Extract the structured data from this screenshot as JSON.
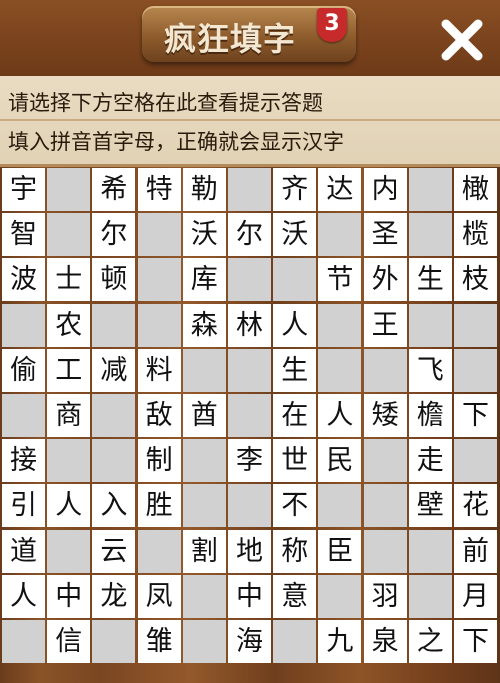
{
  "header": {
    "title": "疯狂填字",
    "level_badge": "3",
    "close_icon": "close-icon"
  },
  "hints": {
    "line1": "请选择下方空格在此查看提示答题",
    "line2": "填入拼音首字母，正确就会显示汉字"
  },
  "grid": [
    [
      "宇",
      "",
      "希",
      "特",
      "勒",
      "",
      "齐",
      "达",
      "内",
      "",
      "橄"
    ],
    [
      "智",
      "",
      "尔",
      "",
      "沃",
      "尔",
      "沃",
      "",
      "圣",
      "",
      "榄"
    ],
    [
      "波",
      "士",
      "顿",
      "",
      "库",
      "",
      "",
      "节",
      "外",
      "生",
      "枝"
    ],
    [
      "",
      "农",
      "",
      "",
      "森",
      "林",
      "人",
      "",
      "王",
      "",
      ""
    ],
    [
      "偷",
      "工",
      "减",
      "料",
      "",
      "",
      "生",
      "",
      "",
      "飞",
      ""
    ],
    [
      "",
      "商",
      "",
      "敌",
      "酋",
      "",
      "在",
      "人",
      "矮",
      "檐",
      "下"
    ],
    [
      "接",
      "",
      "",
      "制",
      "",
      "李",
      "世",
      "民",
      "",
      "走",
      ""
    ],
    [
      "引",
      "人",
      "入",
      "胜",
      "",
      "",
      "不",
      "",
      "",
      "壁",
      "花"
    ],
    [
      "道",
      "",
      "云",
      "",
      "割",
      "地",
      "称",
      "臣",
      "",
      "",
      "前"
    ],
    [
      "人",
      "中",
      "龙",
      "凤",
      "",
      "中",
      "意",
      "",
      "羽",
      "",
      "月"
    ],
    [
      "",
      "信",
      "",
      "雏",
      "",
      "海",
      "",
      "九",
      "泉",
      "之",
      "下"
    ]
  ]
}
